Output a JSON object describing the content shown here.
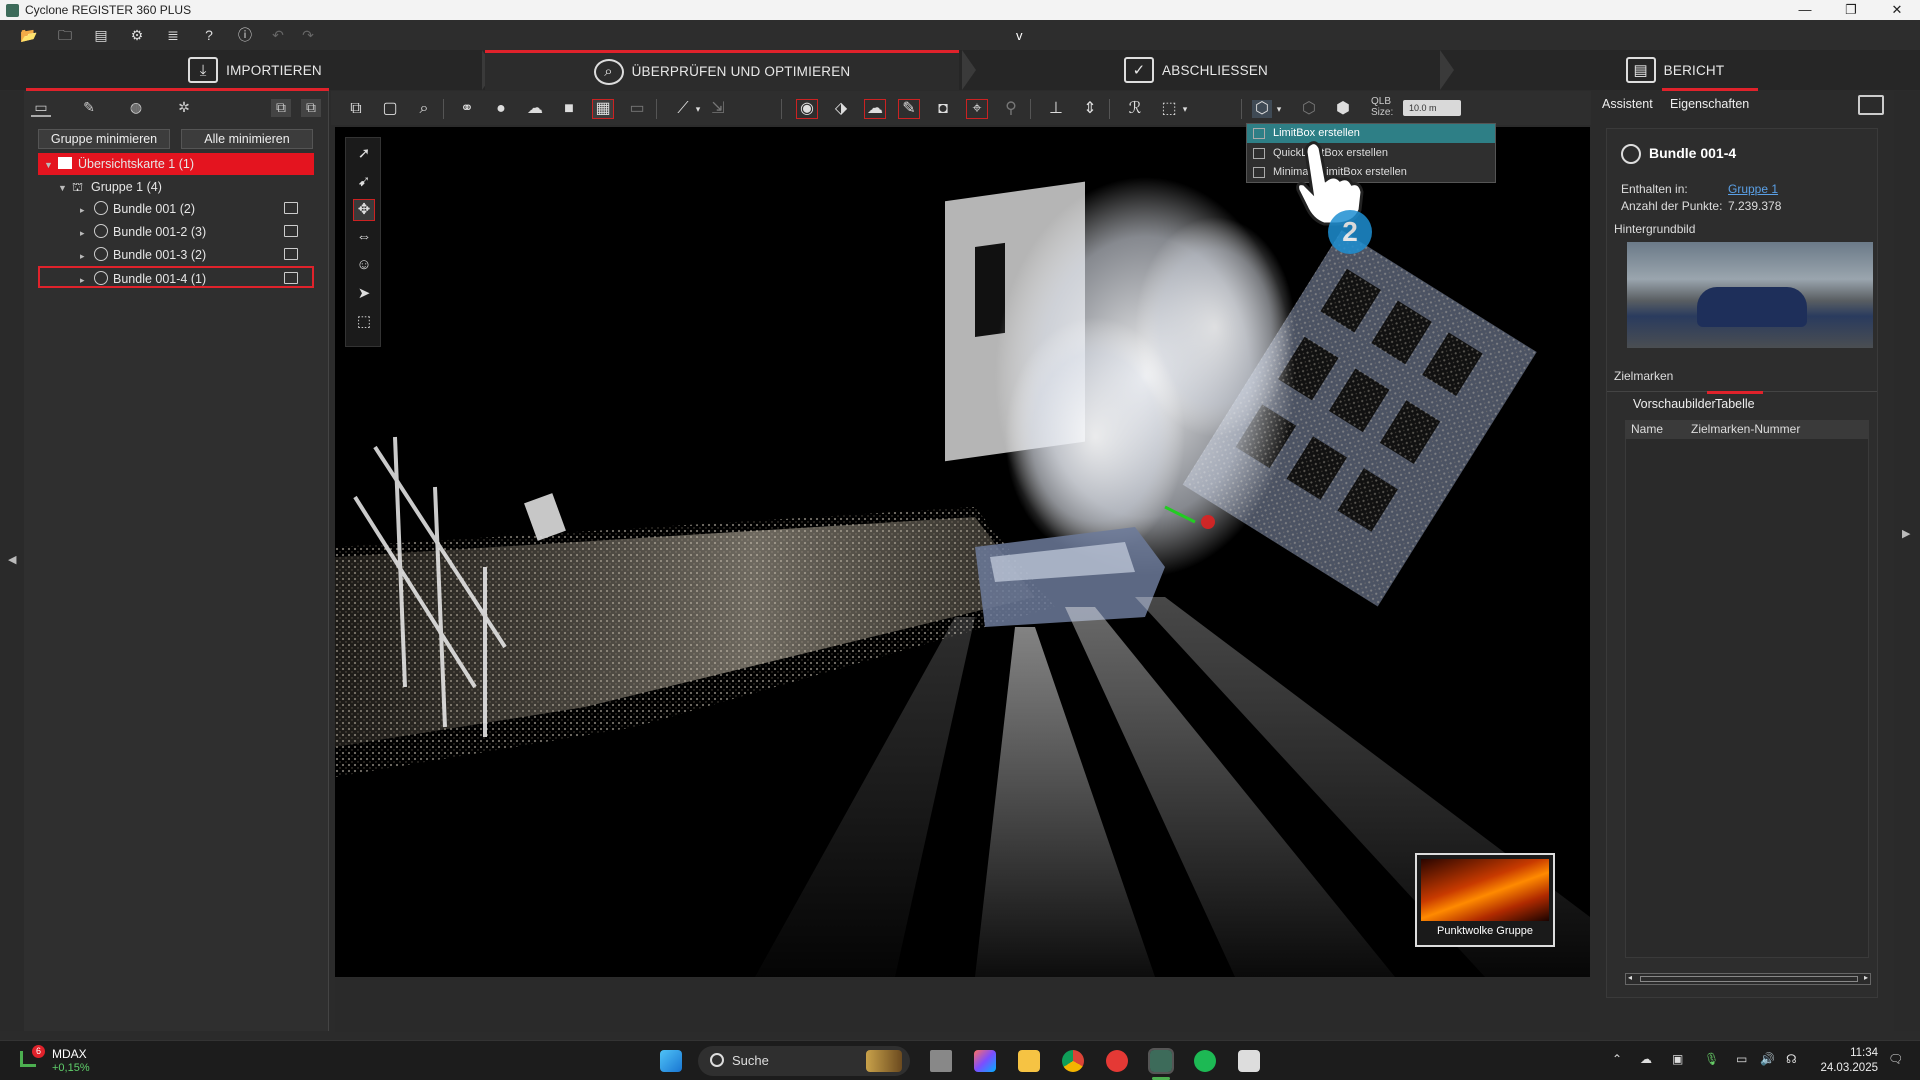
{
  "window": {
    "title": "Cyclone REGISTER 360 PLUS",
    "minimize": "—",
    "restore": "❐",
    "close": "✕"
  },
  "toprow": {
    "center_mark": "v"
  },
  "workflow_tabs": [
    {
      "label": "IMPORTIEREN",
      "active": false
    },
    {
      "label": "ÜBERPRÜFEN UND OPTIMIEREN",
      "active": true
    },
    {
      "label": "ABSCHLIESSEN",
      "active": false
    },
    {
      "label": "BERICHT",
      "active": false
    }
  ],
  "left_panel": {
    "buttons": {
      "minimize_group": "Gruppe minimieren",
      "minimize_all": "Alle minimieren"
    },
    "tree": [
      {
        "label": "Übersichtskarte 1 (1)",
        "level": 0,
        "state": "selected"
      },
      {
        "label": "Gruppe 1 (4)",
        "level": 1,
        "state": "normal"
      },
      {
        "label": "Bundle 001 (2)",
        "level": 2,
        "state": "normal"
      },
      {
        "label": "Bundle 001-2 (3)",
        "level": 2,
        "state": "normal"
      },
      {
        "label": "Bundle 001-3 (2)",
        "level": 2,
        "state": "normal"
      },
      {
        "label": "Bundle 001-4 (1)",
        "level": 2,
        "state": "outlined"
      }
    ]
  },
  "toolbar": {
    "qlb_label_1": "QLB",
    "qlb_label_2": "Size:",
    "qlb_value": "10.0 m"
  },
  "dropdown": {
    "items": [
      {
        "label": "LimitBox erstellen",
        "highlighted": true
      },
      {
        "label": "QuickLimitBox erstellen",
        "highlighted": false
      },
      {
        "label": "Minimale LimitBox erstellen",
        "highlighted": false
      }
    ],
    "step_number": "2"
  },
  "overview_inset": {
    "label": "Punktwolke Gruppe"
  },
  "right_panel": {
    "tabs": {
      "assistant": "Assistent",
      "properties": "Eigenschaften"
    },
    "title": "Bundle 001-4",
    "contained_in_label": "Enthalten in:",
    "contained_in_value": "Gruppe 1",
    "point_count_label": "Anzahl der Punkte:",
    "point_count_value": "7.239.378",
    "background_image_label": "Hintergrundbild",
    "targets_label": "Zielmarken",
    "target_tabs": {
      "thumbnails": "Vorschaubilder",
      "table": "Tabelle"
    },
    "table_columns": [
      "Name",
      "Zielmarken-Nummer"
    ]
  },
  "taskbar": {
    "stock_name": "MDAX",
    "stock_change": "+0,15%",
    "stock_badge": "6",
    "search_placeholder": "Suche",
    "time": "11:34",
    "date": "24.03.2025"
  },
  "colors": {
    "accent_red": "#e0222b",
    "highlight_teal": "#2e7f86",
    "link_blue": "#5aa0e6"
  }
}
